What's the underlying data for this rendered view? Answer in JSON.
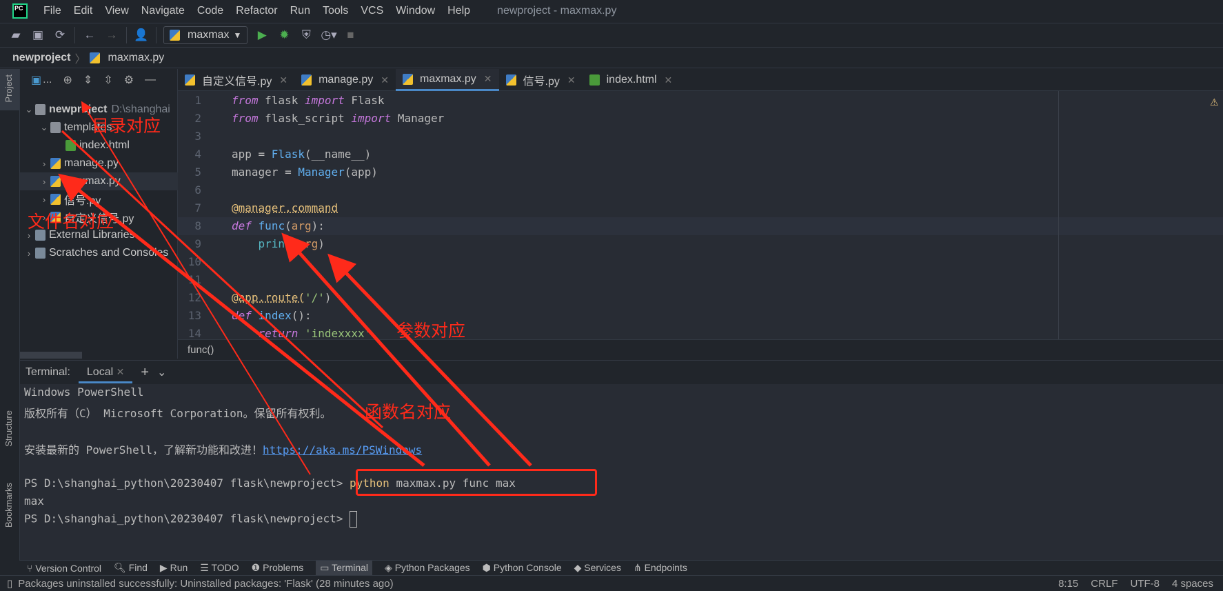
{
  "window": {
    "title": "newproject - maxmax.py",
    "logo": "PC"
  },
  "menu": [
    "File",
    "Edit",
    "View",
    "Navigate",
    "Code",
    "Refactor",
    "Run",
    "Tools",
    "VCS",
    "Window",
    "Help"
  ],
  "toolbar": {
    "run_config": "maxmax",
    "icons": [
      "open-folder-icon",
      "save-icon",
      "sync-icon",
      "back-icon",
      "forward-icon",
      "user-icon",
      "run-icon",
      "debug-icon",
      "coverage-icon",
      "profile-icon",
      "stop-icon"
    ]
  },
  "breadcrumb": {
    "project": "newproject",
    "file": "maxmax.py"
  },
  "sidebar": {
    "project_label": "Project",
    "structure_label": "Structure",
    "bookmarks_label": "Bookmarks",
    "toolbar_label": "..."
  },
  "tree": [
    {
      "label": "newproject",
      "extra": "D:\\shanghai",
      "type": "folder",
      "expanded": true,
      "depth": 0
    },
    {
      "label": "templates",
      "type": "folder",
      "expanded": true,
      "depth": 1
    },
    {
      "label": "index.html",
      "type": "html",
      "depth": 2
    },
    {
      "label": "manage.py",
      "type": "py",
      "depth": 1
    },
    {
      "label": "maxmax.py",
      "type": "py",
      "depth": 1,
      "selected": true
    },
    {
      "label": "信号.py",
      "type": "py",
      "depth": 1
    },
    {
      "label": "自定义信号.py",
      "type": "py",
      "depth": 1
    },
    {
      "label": "External Libraries",
      "type": "lib",
      "depth": 0
    },
    {
      "label": "Scratches and Consoles",
      "type": "lib",
      "depth": 0
    }
  ],
  "tabs": [
    {
      "label": "自定义信号.py",
      "type": "py"
    },
    {
      "label": "manage.py",
      "type": "py"
    },
    {
      "label": "maxmax.py",
      "type": "py",
      "active": true
    },
    {
      "label": "信号.py",
      "type": "py"
    },
    {
      "label": "index.html",
      "type": "html"
    }
  ],
  "code": [
    [
      [
        "from",
        "kw"
      ],
      [
        " flask ",
        ""
      ],
      [
        "import",
        "kw"
      ],
      [
        " Flask",
        ""
      ]
    ],
    [
      [
        "from",
        "kw"
      ],
      [
        " flask_script ",
        ""
      ],
      [
        "import",
        "kw"
      ],
      [
        " Manager",
        ""
      ]
    ],
    [],
    [
      [
        "app = ",
        ""
      ],
      [
        "Flask",
        "fn"
      ],
      [
        "(__name__)",
        ""
      ]
    ],
    [
      [
        "manager = ",
        ""
      ],
      [
        "Manager",
        "fn"
      ],
      [
        "(app)",
        ""
      ]
    ],
    [],
    [
      [
        "@manager.command",
        "dec"
      ]
    ],
    [
      [
        "def",
        "kw"
      ],
      [
        " ",
        ""
      ],
      [
        "func",
        "fn"
      ],
      [
        "(",
        ""
      ],
      [
        "arg",
        "arg"
      ],
      [
        "):",
        ""
      ]
    ],
    [
      [
        "    ",
        ""
      ],
      [
        "print",
        "bi"
      ],
      [
        "(",
        ""
      ],
      [
        "arg",
        "arg"
      ],
      [
        ")",
        ""
      ]
    ],
    [],
    [],
    [
      [
        "@app.route(",
        "dec"
      ],
      [
        "'/'",
        "str"
      ],
      [
        ")",
        ""
      ]
    ],
    [
      [
        "def",
        "kw"
      ],
      [
        " ",
        ""
      ],
      [
        "index",
        "fn"
      ],
      [
        "():",
        ""
      ]
    ],
    [
      [
        "    ",
        ""
      ],
      [
        "return",
        "kw"
      ],
      [
        " ",
        ""
      ],
      [
        "'indexxxx'",
        "str"
      ]
    ]
  ],
  "current_line": 8,
  "editor_crumb": "func()",
  "terminal": {
    "label": "Terminal:",
    "tab": "Local",
    "lines": [
      "Windows PowerShell",
      "版权所有（C） Microsoft Corporation。保留所有权利。",
      "",
      "安装最新的 PowerShell，了解新功能和改进！",
      ""
    ],
    "link": "https://aka.ms/PSWindows",
    "prompt": "PS D:\\shanghai_python\\20230407 flask\\newproject> ",
    "cmd_python": "python",
    "cmd_rest": " maxmax.py func max",
    "output": "max"
  },
  "tool_windows": [
    "Version Control",
    "Find",
    "Run",
    "TODO",
    "Problems",
    "Terminal",
    "Python Packages",
    "Python Console",
    "Services",
    "Endpoints"
  ],
  "active_tool": "Terminal",
  "status": {
    "message": "Packages uninstalled successfully: Uninstalled packages: 'Flask' (28 minutes ago)",
    "position": "8:15",
    "line_sep": "CRLF",
    "encoding": "UTF-8",
    "indent": "4 spaces"
  },
  "annotations": {
    "dir": "目录对应",
    "file": "文件名对应",
    "param": "参数对应",
    "func": "函数名对应",
    "color": "#ff2a1a"
  }
}
